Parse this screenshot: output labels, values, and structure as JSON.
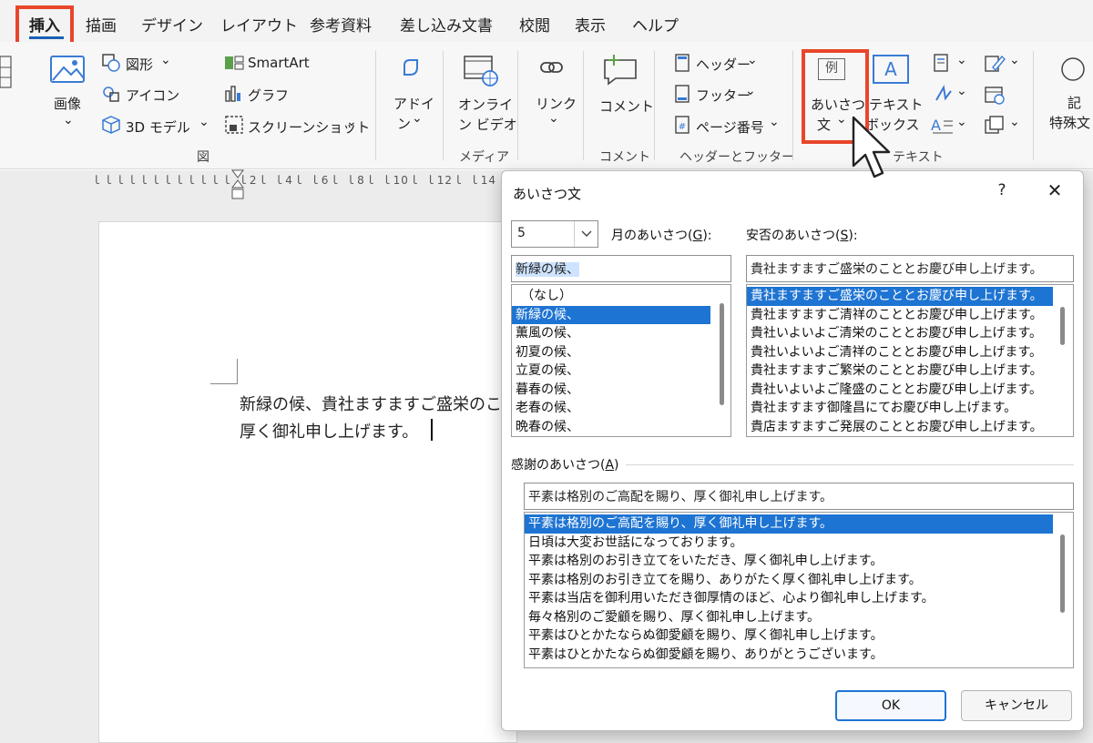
{
  "tabs": [
    "挿入",
    "描画",
    "デザイン",
    "レイアウト",
    "参考資料",
    "差し込み文書",
    "校閲",
    "表示",
    "ヘルプ"
  ],
  "ribbon": {
    "images_label": "画像",
    "shapes_label": "図形",
    "icons_label": "アイコン",
    "model3d_label": "3D モデル",
    "smartart_label": "SmartArt",
    "chart_label": "グラフ",
    "screenshot_label": "スクリーンショット",
    "group_illustrations": "図",
    "addins_line1": "アドイ",
    "addins_line2": "ン",
    "online_video_line1": "オンライ",
    "online_video_line2": "ン ビデオ",
    "group_media": "メディア",
    "link_label": "リンク",
    "comment_label": "コメント",
    "group_comment": "コメント",
    "header_label": "ヘッダー",
    "footer_label": "フッター",
    "page_number_label": "ページ番号",
    "group_header_footer": "ヘッダーとフッター",
    "greeting_icon_text": "例",
    "greeting_line1": "あいさつ",
    "greeting_line2": "文",
    "textbox_line1": "テキスト",
    "textbox_line2": "ボックス",
    "textbox_icon_text": "A",
    "group_text": "テキスト",
    "symbols_line1": "記",
    "symbols_line2": "特殊文"
  },
  "document": {
    "ruler": "ｌｌｌｌｌｌｌｌｌｌｌｌ ｌ2ｌ ｌ4ｌ ｌ6ｌ ｌ8ｌ ｌ10ｌ ｌ12ｌ ｌ14ｌ",
    "line1": "新緑の候、貴社ますますご盛栄のこ",
    "line2": "厚く御礼申し上げます。"
  },
  "dialog": {
    "title": "あいさつ文",
    "help": "?",
    "close": "✕",
    "month_value": "5",
    "month_label": "月のあいさつ(",
    "month_key": "G",
    "month_label_end": "):",
    "safety_label": "安否のあいさつ(",
    "safety_key": "S",
    "safety_label_end": "):",
    "month_input": "新緑の候、",
    "safety_input": "貴社ますますご盛栄のこととお慶び申し上げます。",
    "month_items": [
      "（なし）",
      "新緑の候、",
      "薫風の候、",
      "初夏の候、",
      "立夏の候、",
      "暮春の候、",
      "老春の候、",
      "晩春の候、"
    ],
    "safety_items": [
      "貴社ますますご盛栄のこととお慶び申し上げます。",
      "貴社ますますご清祥のこととお慶び申し上げます。",
      "貴社いよいよご清栄のこととお慶び申し上げます。",
      "貴社いよいよご清祥のこととお慶び申し上げます。",
      "貴社ますますご繁栄のこととお慶び申し上げます。",
      "貴社いよいよご隆盛のこととお慶び申し上げます。",
      "貴社ますます御隆昌にてお慶び申し上げます。",
      "貴店ますますご発展のこととお慶び申し上げます。"
    ],
    "thanks_label": "感謝のあいさつ(",
    "thanks_key": "A",
    "thanks_label_end": ")",
    "thanks_input": "平素は格別のご高配を賜り、厚く御礼申し上げます。",
    "thanks_items": [
      "平素は格別のご高配を賜り、厚く御礼申し上げます。",
      "日頃は大変お世話になっております。",
      "平素は格別のお引き立てをいただき、厚く御礼申し上げます。",
      "平素は格別のお引き立てを賜り、ありがたく厚く御礼申し上げます。",
      "平素は当店を御利用いただき御厚情のほど、心より御礼申し上げます。",
      "毎々格別のご愛顧を賜り、厚く御礼申し上げます。",
      "平素はひとかたならぬ御愛顧を賜り、厚く御礼申し上げます。",
      "平素はひとかたならぬ御愛顧を賜り、ありがとうございます。"
    ],
    "ok": "OK",
    "cancel": "キャンセル"
  },
  "colors": {
    "highlight_box": "#e8462b",
    "selection": "#1e74d2",
    "accent": "#1a5fb4"
  }
}
